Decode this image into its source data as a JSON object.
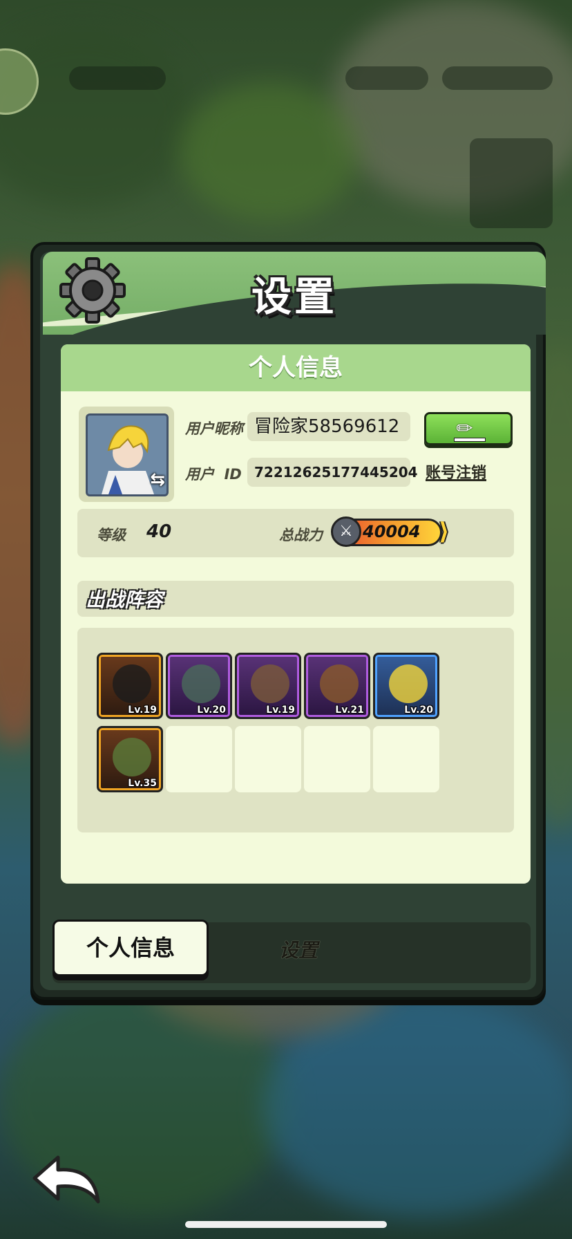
{
  "dialog": {
    "title": "设置",
    "card_title": "个人信息"
  },
  "profile": {
    "nickname_label": "用户昵称",
    "nickname": "冒险家58569612",
    "id_label": "用户  ID",
    "user_id": "72212625177445204",
    "logout_label": "账号注销",
    "level_label": "等级",
    "level": "40",
    "power_label": "总战力",
    "power": "40004"
  },
  "lineup": {
    "title": "出战阵容",
    "heroes": [
      {
        "level": "Lv.19",
        "rarity": "gold"
      },
      {
        "level": "Lv.20",
        "rarity": "purple"
      },
      {
        "level": "Lv.19",
        "rarity": "purple"
      },
      {
        "level": "Lv.21",
        "rarity": "purple"
      },
      {
        "level": "Lv.20",
        "rarity": "blue"
      },
      {
        "level": "Lv.35",
        "rarity": "gold"
      }
    ]
  },
  "tabs": {
    "profile": "个人信息",
    "settings": "设置"
  },
  "icons": {
    "gear": "gear-icon",
    "edit": "pencil-icon",
    "swap": "swap-icon",
    "power": "crossed-swords-icon",
    "back": "back-arrow-icon"
  },
  "colors": {
    "header_green": "#8bc07a",
    "card_bg": "#f3fadb",
    "edit_button": "#5bb236",
    "gold_frame": "#f0a524",
    "purple_frame": "#b05ce0",
    "blue_frame": "#4fa2ff"
  }
}
